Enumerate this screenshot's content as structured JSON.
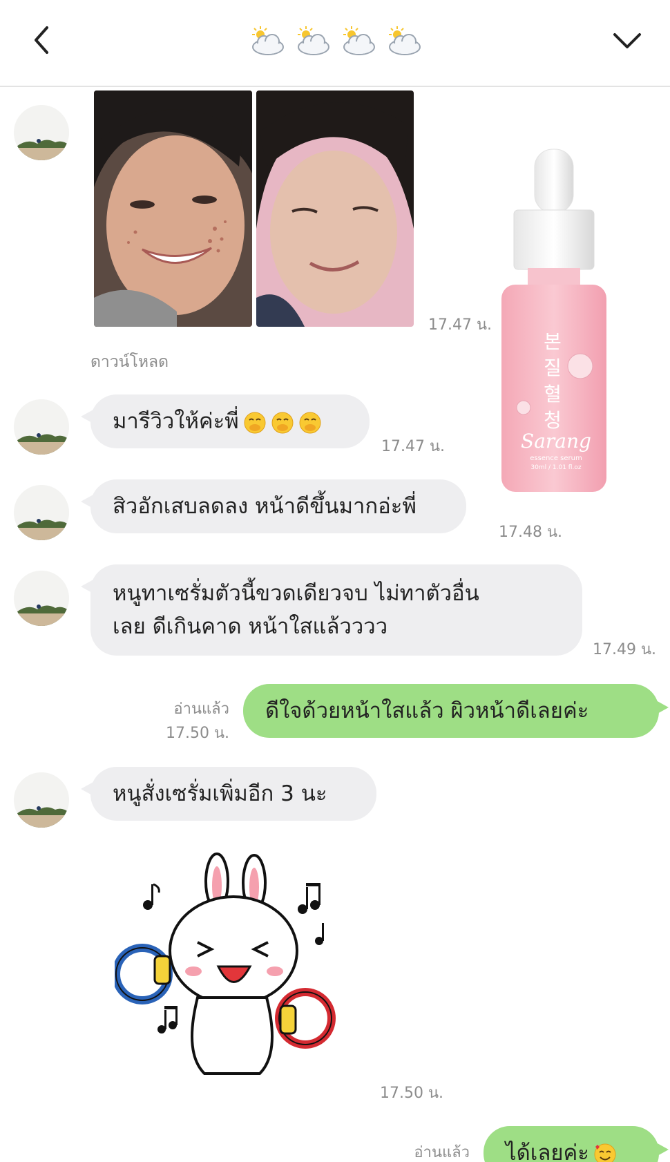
{
  "header": {
    "back_icon": "chevron-left-icon",
    "menu_icon": "chevron-down-icon",
    "title_icons": [
      "sun-behind-cloud-icon",
      "sun-behind-cloud-icon",
      "sun-behind-cloud-icon",
      "sun-behind-cloud-icon"
    ]
  },
  "messages": {
    "photos": {
      "time": "17.47 น.",
      "download_label": "ดาวน์โหลด"
    },
    "m1": {
      "text": "มารีวิวให้ค่ะพี่",
      "time": "17.47 น.",
      "emoji": "face-with-hand-over-mouth-icon"
    },
    "m2": {
      "text": "สิวอักเสบลดลง หน้าดีขึ้นมากอ่ะพี่",
      "time": "17.48 น."
    },
    "m3": {
      "line1": "หนูทาเซรั่มตัวนี้ขวดเดียวจบ ไม่ทาตัวอื่น",
      "line2": "เลย ดีเกินคาด หน้าใสแล้วววว",
      "time": "17.49 น."
    },
    "m4": {
      "text": "ดีใจด้วยหน้าใสแล้ว ผิวหน้าดีเลยค่ะ",
      "read": "อ่านแล้ว",
      "time": "17.50 น."
    },
    "m5": {
      "text": "หนูสั่งเซรั่มเพิ่มอีก 3 นะ"
    },
    "sticker": {
      "time": "17.50 น.",
      "name": "bunny-tambourine-sticker"
    },
    "m6": {
      "text": "ได้เลยค่ะ",
      "read": "อ่านแล้ว",
      "emoji": "smiling-face-with-hearts-icon"
    }
  },
  "product": {
    "korean": [
      "본",
      "질",
      "혈",
      "청"
    ],
    "brand": "Sarang",
    "subtitle": "essence serum",
    "volume": "30ml / 1.01 fl.oz"
  },
  "colors": {
    "my_bubble": "#9ede85",
    "their_bubble": "#eeeef0",
    "serum_pink": "#f6b9c4"
  }
}
